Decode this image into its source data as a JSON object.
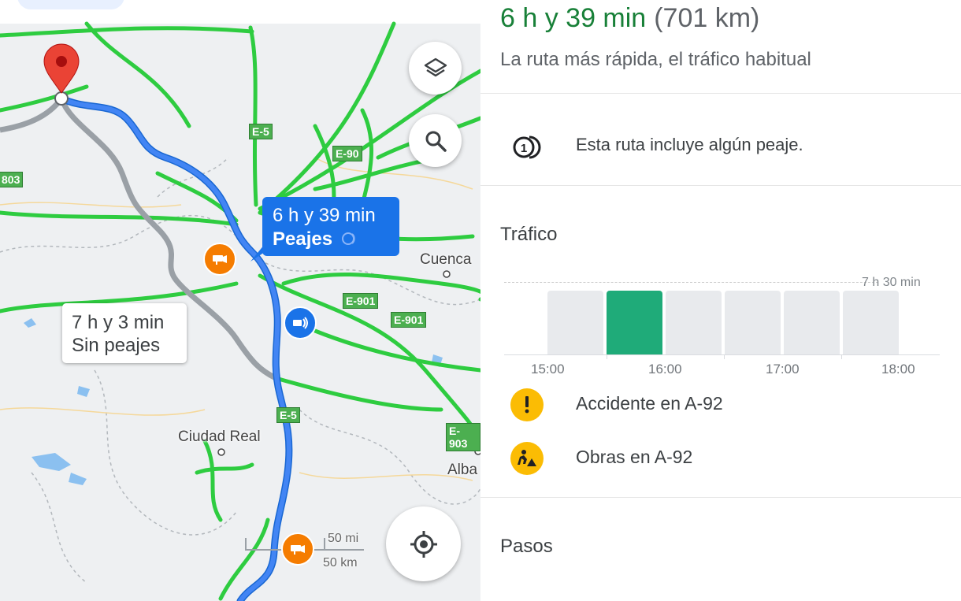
{
  "map": {
    "route_primary": {
      "duration": "6 h y 39 min",
      "note": "Peajes"
    },
    "route_alternative": {
      "duration": "7 h y 3 min",
      "note": "Sin peajes"
    },
    "place_labels": [
      "Cuenca",
      "Ciudad Real",
      "Alba"
    ],
    "road_shields": [
      "E-5",
      "E-90",
      "E-901",
      "E-901",
      "E-5",
      "E-903",
      "803"
    ],
    "scale": {
      "miles": "50 mi",
      "km": "50 km"
    },
    "controls": [
      "layers-icon",
      "search-icon",
      "my-location-icon"
    ],
    "colors": {
      "route": "#4285f4",
      "alt_route": "#9aa0a6",
      "traffic": "#2ecc40",
      "pin": "#ea4335",
      "camera_badge": "#f57c00",
      "speed_badge": "#1a73e8"
    }
  },
  "panel": {
    "eta": "6 h y 39 min",
    "distance": "(701 km)",
    "subtitle": "La ruta más rápida, el tráfico habitual",
    "toll_notice": "Esta ruta incluye algún peaje.",
    "traffic": {
      "title": "Tráfico",
      "max_label": "7 h 30 min",
      "ticks": [
        "15:00",
        "16:00",
        "17:00",
        "18:00"
      ],
      "active_index": 1,
      "bars": [
        0.97,
        0.97,
        0.97,
        0.97,
        0.97,
        0.97
      ]
    },
    "incidents": [
      {
        "icon": "alert-icon",
        "text": "Accidente en A-92"
      },
      {
        "icon": "road-works-icon",
        "text": "Obras en A-92"
      }
    ],
    "steps_title": "Pasos"
  },
  "colors": {
    "eta_green": "#188038",
    "bar_active": "#1fab79",
    "bar_inactive": "#e8eaed",
    "incident_yellow": "#fbbc04"
  }
}
